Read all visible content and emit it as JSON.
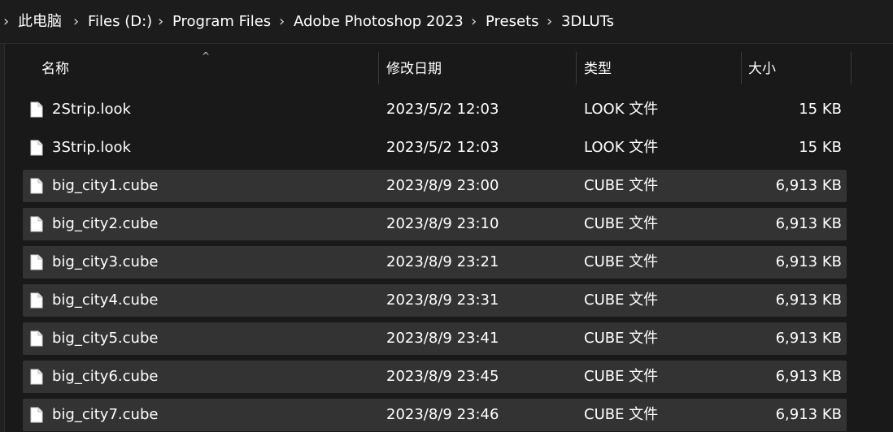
{
  "breadcrumb": {
    "items": [
      {
        "label": "此电脑"
      },
      {
        "label": "Files (D:)"
      },
      {
        "label": "Program Files"
      },
      {
        "label": "Adobe Photoshop 2023"
      },
      {
        "label": "Presets"
      },
      {
        "label": "3DLUTs"
      }
    ]
  },
  "columns": {
    "name": "名称",
    "modified": "修改日期",
    "type": "类型",
    "size": "大小",
    "sort_indicator": "^"
  },
  "files": [
    {
      "name": "2Strip.look",
      "modified": "2023/5/2 12:03",
      "type": "LOOK 文件",
      "size": "15 KB",
      "selected": false
    },
    {
      "name": "3Strip.look",
      "modified": "2023/5/2 12:03",
      "type": "LOOK 文件",
      "size": "15 KB",
      "selected": false
    },
    {
      "name": "big_city1.cube",
      "modified": "2023/8/9 23:00",
      "type": "CUBE 文件",
      "size": "6,913 KB",
      "selected": true
    },
    {
      "name": "big_city2.cube",
      "modified": "2023/8/9 23:10",
      "type": "CUBE 文件",
      "size": "6,913 KB",
      "selected": true
    },
    {
      "name": "big_city3.cube",
      "modified": "2023/8/9 23:21",
      "type": "CUBE 文件",
      "size": "6,913 KB",
      "selected": true
    },
    {
      "name": "big_city4.cube",
      "modified": "2023/8/9 23:31",
      "type": "CUBE 文件",
      "size": "6,913 KB",
      "selected": true
    },
    {
      "name": "big_city5.cube",
      "modified": "2023/8/9 23:41",
      "type": "CUBE 文件",
      "size": "6,913 KB",
      "selected": true
    },
    {
      "name": "big_city6.cube",
      "modified": "2023/8/9 23:45",
      "type": "CUBE 文件",
      "size": "6,913 KB",
      "selected": true
    },
    {
      "name": "big_city7.cube",
      "modified": "2023/8/9 23:46",
      "type": "CUBE 文件",
      "size": "6,913 KB",
      "selected": true
    }
  ],
  "icons": {
    "breadcrumb_separator": "chevron-right-icon",
    "file": "document-icon"
  },
  "colors": {
    "background": "#191919",
    "selected_row": "#333333",
    "text": "#ffffff"
  }
}
